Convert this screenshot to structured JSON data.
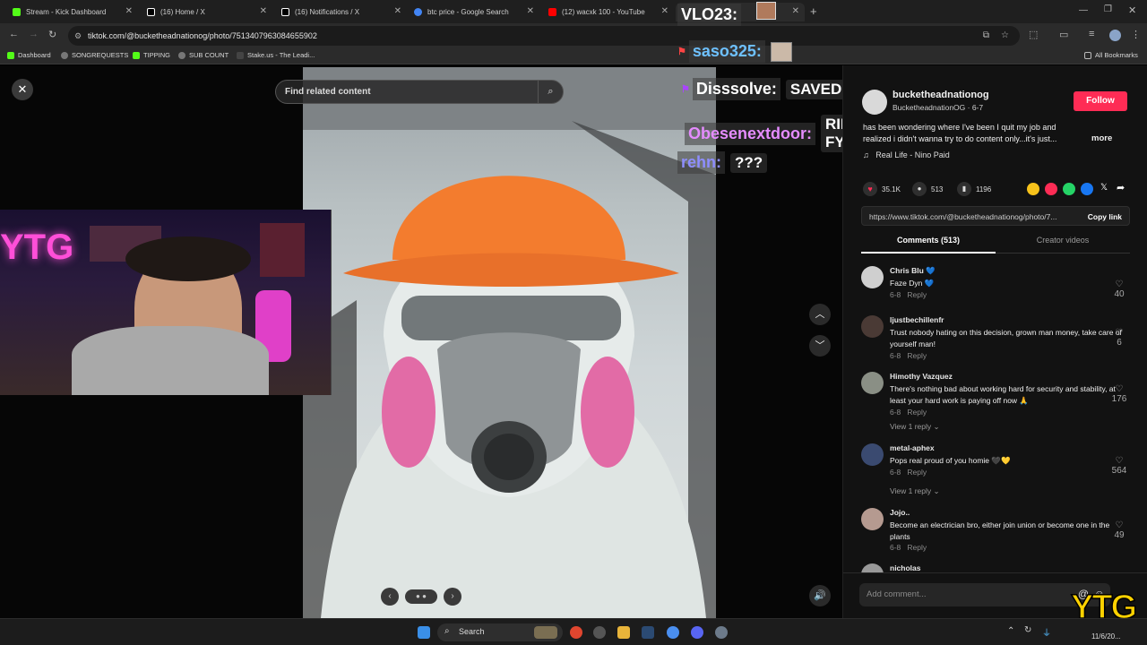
{
  "tabs": [
    {
      "title": "Stream - Kick Dashboard",
      "color": "#53fc18"
    },
    {
      "title": "(16) Home / X",
      "color": "#ffffff"
    },
    {
      "title": "(16) Notifications / X",
      "color": "#ffffff"
    },
    {
      "title": "btc price - Google Search",
      "color": "#4285f4"
    },
    {
      "title": "(12) wacxk 100 - YouTube",
      "color": "#ff0000"
    }
  ],
  "address": "tiktok.com/@bucketheadnationog/photo/7513407963084655902",
  "bookmarks": [
    "Dashboard",
    "SONGREQUESTS",
    "TIPPING",
    "SUB COUNT",
    "Stake.us - The Leadi...",
    "All Bookmarks"
  ],
  "search": {
    "placeholder": "Find related content"
  },
  "chat": [
    {
      "name": "VLO23:",
      "msg": "",
      "color": "#ffffff"
    },
    {
      "name": "saso325:",
      "msg": "",
      "color": "#6ec1ff"
    },
    {
      "name": "Disssolve:",
      "msg": "SAVED?",
      "color": "#ffffff"
    },
    {
      "name": "Obesenextdoor:",
      "msg": "RIFET FYP",
      "color": "#e58cff"
    },
    {
      "name": "rehn:",
      "msg": "???",
      "color": "#8e8eff"
    }
  ],
  "webcam_sign": "YTG",
  "post": {
    "username": "bucketheadnationog",
    "handle": "BucketheadnationOG · 6-7",
    "follow": "Follow",
    "caption": "has been wondering where I've been I quit my job and realized i didn't wanna try to do content only...it's just...",
    "more": "more",
    "music": "Real Life - Nino Paid",
    "likes": "35.1K",
    "comments_count": "513",
    "saves": "1196",
    "link": "https://www.tiktok.com/@bucketheadnationog/photo/7...",
    "copy_link": "Copy link"
  },
  "tabs_panel": {
    "comments": "Comments (513)",
    "creator": "Creator videos"
  },
  "comments": [
    {
      "name": "Chris Blu 💙",
      "text": "Faze Dyn 💙",
      "date": "6-8",
      "reply": "Reply",
      "likes": "40",
      "view": ""
    },
    {
      "name": "ljustbechillenfr",
      "text": "Trust nobody hating on this decision, grown man money, take care of yourself man!",
      "date": "6-8",
      "reply": "Reply",
      "likes": "6",
      "view": ""
    },
    {
      "name": "Himothy Vazquez",
      "text": "There's nothing bad about working hard for security and stability, at least your hard work is paying off now 🙏",
      "date": "6-8",
      "reply": "Reply",
      "likes": "176",
      "view": "View 1 reply"
    },
    {
      "name": "metal-aphex",
      "text": "Pops real proud of you homie 🖤💛",
      "date": "6-8",
      "reply": "Reply",
      "likes": "564",
      "view": "View 1 reply"
    },
    {
      "name": "Jojo..",
      "text": "Become an electrician bro, either join union or become one in the plants",
      "date": "6-8",
      "reply": "Reply",
      "likes": "49",
      "view": ""
    },
    {
      "name": "nicholas",
      "text": "",
      "date": "",
      "reply": "",
      "likes": "",
      "view": ""
    }
  ],
  "add_comment": "Add comment...",
  "taskbar": {
    "search": "Search",
    "date": "11/6/20..."
  },
  "corner_logo": "YTG"
}
